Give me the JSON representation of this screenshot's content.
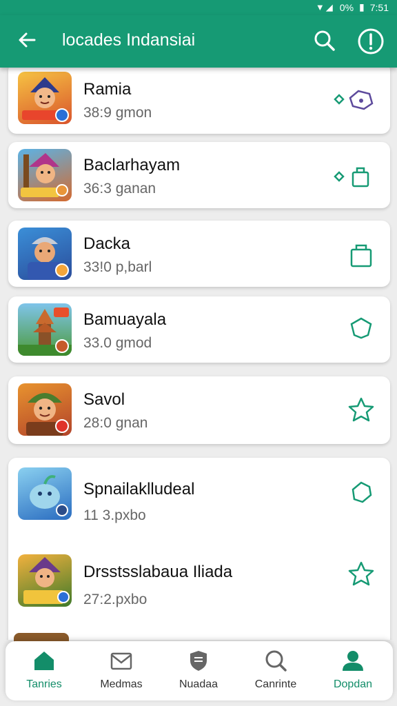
{
  "status": {
    "battery": "0%",
    "time": "7:51"
  },
  "appbar": {
    "title": "locades Indansiai"
  },
  "items": [
    {
      "name": "Ramia",
      "detail": "38:9 gmon"
    },
    {
      "name": "Baclarhayam",
      "detail": "36:3 ganan"
    },
    {
      "name": "Dacka",
      "detail": "33!0 p,barl"
    },
    {
      "name": "Bamuayala",
      "detail": "33.0 gmod"
    },
    {
      "name": "Savol",
      "detail": "28:0 gnan"
    },
    {
      "name": "Spnailaklludeal",
      "detail": "11 3.pxbo"
    },
    {
      "name": "Drsstsslabaua Iliada",
      "detail": "27:2.pxbo"
    }
  ],
  "thumb_badges": [
    "DCBDAD",
    "DBDAD",
    "DGBCAD"
  ],
  "nav": [
    {
      "label": "Tanries",
      "icon": "home-icon"
    },
    {
      "label": "Medmas",
      "icon": "mail-icon"
    },
    {
      "label": "Nuadaa",
      "icon": "shield-icon"
    },
    {
      "label": "Canrinte",
      "icon": "search-icon"
    },
    {
      "label": "Dopdan",
      "icon": "person-icon"
    }
  ],
  "colors": {
    "primary": "#169a74",
    "accent": "#138d69",
    "background": "#ededed"
  }
}
